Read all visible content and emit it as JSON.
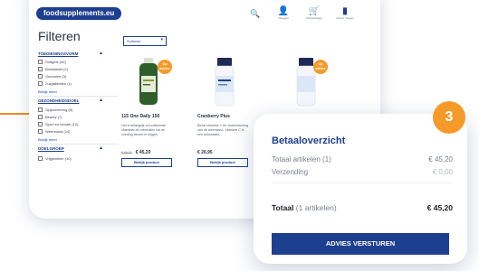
{
  "header": {
    "logo_text": "foodsupplements.eu",
    "icons": [
      {
        "name": "user-icon",
        "glyph": "👤",
        "label": "Inloggen"
      },
      {
        "name": "cart-icon",
        "glyph": "🛒",
        "label": "Winkelwagen"
      },
      {
        "name": "info-icon",
        "glyph": "▮",
        "label": "Advies Vragen"
      }
    ]
  },
  "filters": {
    "title": "Filteren",
    "sections": [
      {
        "heading": "TOEDIENINGSVORM",
        "items": [
          "Softgels (40)",
          "Bruistablet (2)",
          "Gummies (3)",
          "Zuigtabletten (1)"
        ],
        "more": "Bekijk meer"
      },
      {
        "heading": "GEZONDHEIDSDOEL",
        "items": [
          "Spijsvertering (8)",
          "Beauty (7)",
          "Sport en herstel (12)",
          "Weerstand (14)"
        ],
        "more": "Bekijk meer"
      },
      {
        "heading": "DOELGROEP",
        "items": [
          "Vrijgezellen (10)"
        ],
        "more": ""
      }
    ]
  },
  "sort": {
    "label": "Sorteren"
  },
  "products": [
    {
      "name": "115 One Daily 150",
      "desc": "Het is belangrijk om voldoende vitaminen en mineralen via de voeding binnen te krijgen.",
      "old_price": "€ 59,20",
      "price": "€ 45,20",
      "button": "Bekijk product",
      "badge": "Op advies"
    },
    {
      "name": "Cranberry Plus",
      "desc": "Bevat vitamine C ter ondersteuning van de weerstand. Vitamine C is een antioxidant.",
      "old_price": "",
      "price": "€ 26,95",
      "button": "Bekijk product",
      "badge": ""
    },
    {
      "name": "",
      "desc": "",
      "old_price": "",
      "price": "",
      "button": "",
      "badge": "Op advies"
    }
  ],
  "overview": {
    "step": "3",
    "title": "Betaaloverzicht",
    "subtotal_label": "Totaal artikelen (1)",
    "subtotal_value": "€ 45,20",
    "shipping_label": "Verzending",
    "shipping_value": "€ 0,00",
    "total_label": "Totaal",
    "total_sub": "(1 artikelen)",
    "total_value": "€ 45,20",
    "cta": "ADVIES VERSTUREN"
  },
  "colors": {
    "brand": "#1d3f8f",
    "accent": "#f59a2a"
  }
}
